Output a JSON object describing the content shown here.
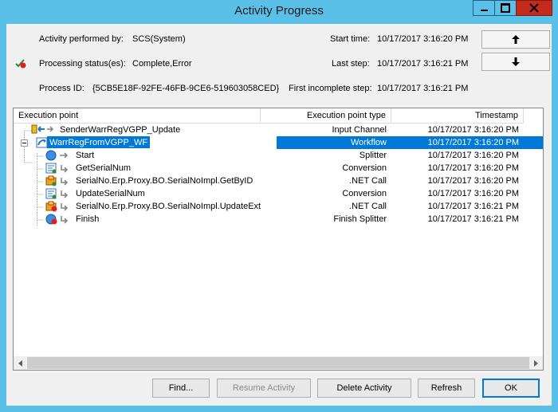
{
  "window": {
    "title": "Activity Progress"
  },
  "caption_buttons": {
    "minimize": "–",
    "maximize": "□",
    "close": "✕"
  },
  "info": {
    "performed_by_label": "Activity performed by:",
    "performed_by_value": "SCS(System)",
    "status_label": "Processing status(es):",
    "status_value": "Complete,Error",
    "process_id_label": "Process ID:",
    "process_id_value": "{5CB5E18F-92FE-46FB-9CE6-519603058CED}",
    "start_time_label": "Start time:",
    "start_time_value": "10/17/2017 3:16:20 PM",
    "last_step_label": "Last step:",
    "last_step_value": "10/17/2017 3:16:21 PM",
    "first_incomplete_label": "First incomplete step:",
    "first_incomplete_value": "10/17/2017 3:16:21 PM"
  },
  "list": {
    "columns": [
      "Execution point",
      "Execution point type",
      "Timestamp"
    ],
    "rows": [
      {
        "name": "SenderWarrRegVGPP_Update",
        "type": "Input Channel",
        "timestamp": "10/17/2017 3:16:20 PM",
        "icon": "input-channel-icon"
      },
      {
        "name": "WarrRegFromVGPP_WF",
        "type": "Workflow",
        "timestamp": "10/17/2017 3:16:20 PM",
        "icon": "workflow-icon",
        "selected": true
      },
      {
        "name": "Start",
        "type": "Splitter",
        "timestamp": "10/17/2017 3:16:20 PM",
        "icon": "splitter-icon"
      },
      {
        "name": "GetSerialNum",
        "type": "Conversion",
        "timestamp": "10/17/2017 3:16:20 PM",
        "icon": "conversion-icon"
      },
      {
        "name": "SerialNo.Erp.Proxy.BO.SerialNoImpl.GetByID",
        "type": ".NET Call",
        "timestamp": "10/17/2017 3:16:20 PM",
        "icon": "net-call-icon"
      },
      {
        "name": "UpdateSerialNum",
        "type": "Conversion",
        "timestamp": "10/17/2017 3:16:20 PM",
        "icon": "conversion-icon"
      },
      {
        "name": "SerialNo.Erp.Proxy.BO.SerialNoImpl.UpdateExt",
        "type": ".NET Call",
        "timestamp": "10/17/2017 3:16:21 PM",
        "icon": "net-call-error-icon"
      },
      {
        "name": "Finish",
        "type": "Finish Splitter",
        "timestamp": "10/17/2017 3:16:21 PM",
        "icon": "finish-splitter-error-icon"
      }
    ]
  },
  "buttons": {
    "find": "Find...",
    "resume": "Resume Activity",
    "delete": "Delete Activity",
    "refresh": "Refresh",
    "ok": "OK"
  },
  "colors": {
    "selection": "#0078d7",
    "titlebar": "#5bc0e8",
    "close": "#c42b1c"
  }
}
